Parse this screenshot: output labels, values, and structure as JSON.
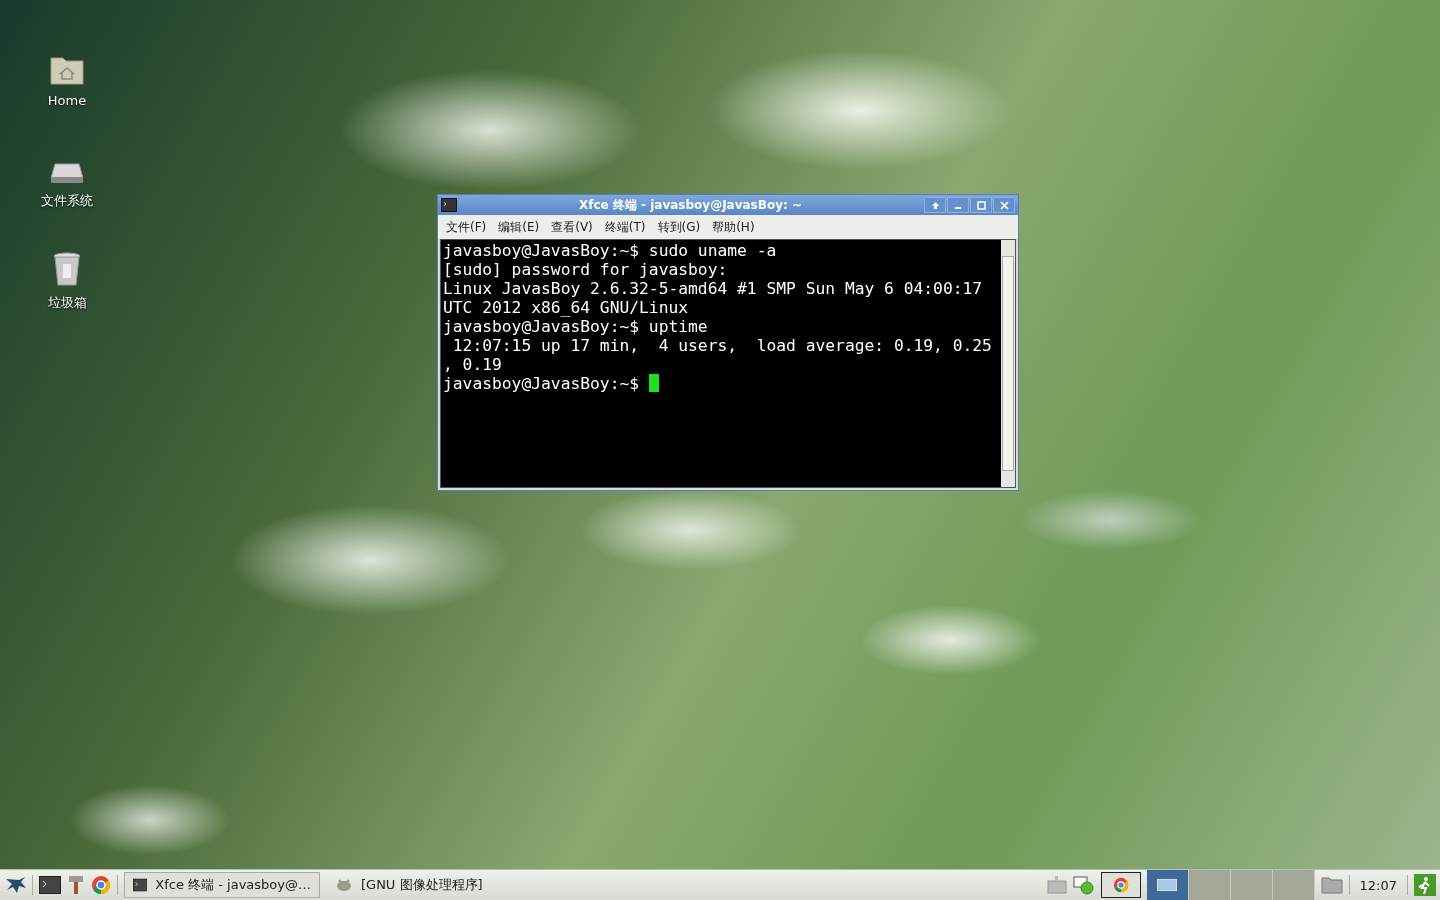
{
  "desktop_icons": [
    {
      "label": "Home",
      "kind": "home"
    },
    {
      "label": "文件系统",
      "kind": "drive"
    },
    {
      "label": "垃圾箱",
      "kind": "trash"
    }
  ],
  "terminal": {
    "title": "Xfce 终端 - javasboy@JavasBoy: ~",
    "menu": [
      "文件(F)",
      "编辑(E)",
      "查看(V)",
      "终端(T)",
      "转到(G)",
      "帮助(H)"
    ],
    "lines": [
      "javasboy@JavasBoy:~$ sudo uname -a",
      "[sudo] password for javasboy:",
      "Linux JavasBoy 2.6.32-5-amd64 #1 SMP Sun May 6 04:00:17",
      "UTC 2012 x86_64 GNU/Linux",
      "javasboy@JavasBoy:~$ uptime",
      " 12:07:15 up 17 min,  4 users,  load average: 0.19, 0.25",
      ", 0.19",
      "javasboy@JavasBoy:~$ "
    ]
  },
  "taskbar": {
    "tasks": [
      {
        "label": "Xfce 终端 - javasboy@…",
        "kind": "terminal",
        "selected": true
      },
      {
        "label": "[GNU 图像处理程序]",
        "kind": "gimp",
        "selected": false
      }
    ],
    "workspaces": [
      {
        "selected": true
      },
      {
        "selected": false
      },
      {
        "selected": false
      },
      {
        "selected": false
      }
    ],
    "clock": "12:07"
  }
}
